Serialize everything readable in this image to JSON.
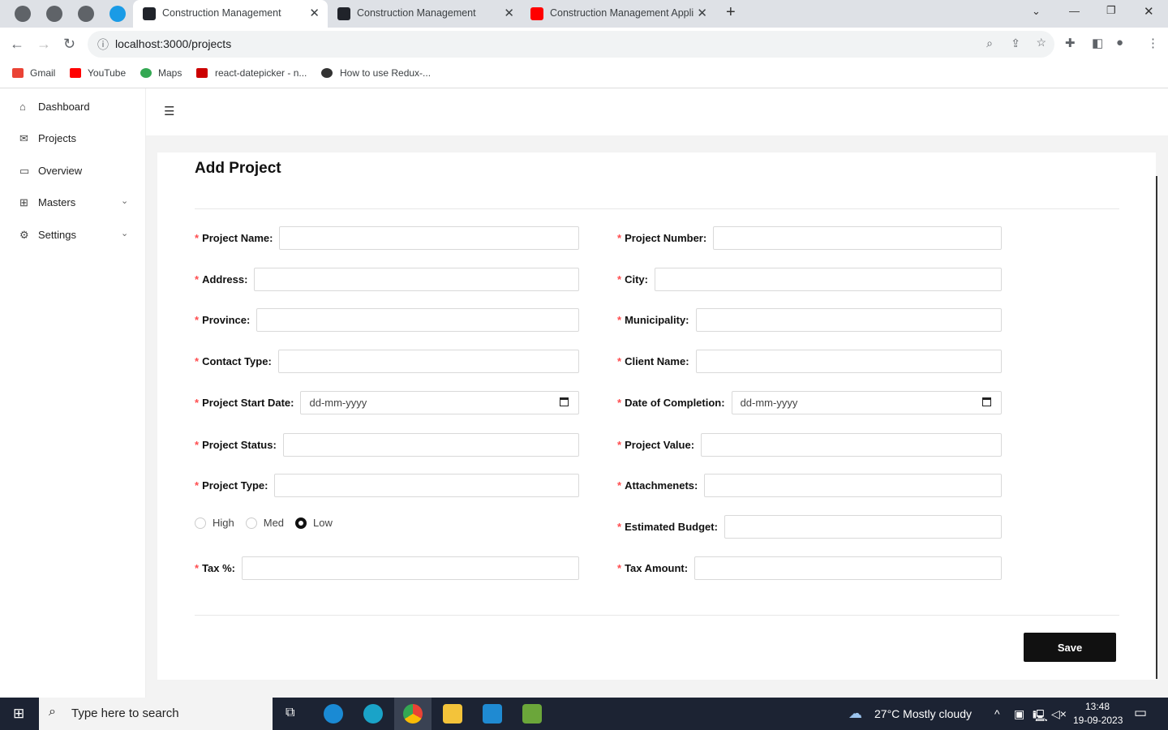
{
  "browser": {
    "tabs": [
      {
        "title": "Construction Management",
        "active": true
      },
      {
        "title": "Construction Management",
        "active": false
      },
      {
        "title": "Construction Management Appli",
        "active": false
      }
    ],
    "url": "localhost:3000/projects",
    "bookmarks": [
      "Gmail",
      "YouTube",
      "Maps",
      "react-datepicker - n...",
      "How to use Redux-..."
    ]
  },
  "sidebar": {
    "items": [
      {
        "label": "Dashboard",
        "icon": "home-icon"
      },
      {
        "label": "Projects",
        "icon": "mail-icon"
      },
      {
        "label": "Overview",
        "icon": "calendar-icon"
      },
      {
        "label": "Masters",
        "icon": "grid-icon"
      },
      {
        "label": "Settings",
        "icon": "gear-icon"
      }
    ]
  },
  "form": {
    "title": "Add Project",
    "left": [
      {
        "label": "Project Name:",
        "value": ""
      },
      {
        "label": "Address:",
        "value": ""
      },
      {
        "label": "Province:",
        "value": ""
      },
      {
        "label": "Contact Type:",
        "value": ""
      },
      {
        "label": "Project Start Date:",
        "value": "dd-mm-yyyy"
      },
      {
        "label": "Project Status:",
        "value": ""
      },
      {
        "label": "Project Type:",
        "value": ""
      },
      {
        "label": "Tax %:",
        "value": ""
      }
    ],
    "right": [
      {
        "label": "Project Number:",
        "value": ""
      },
      {
        "label": "City:",
        "value": ""
      },
      {
        "label": "Municipality:",
        "value": ""
      },
      {
        "label": "Client Name:",
        "value": ""
      },
      {
        "label": "Date of Completion:",
        "value": "dd-mm-yyyy"
      },
      {
        "label": "Project Value:",
        "value": ""
      },
      {
        "label": "Attachmenets:",
        "value": ""
      },
      {
        "label": "Estimated Budget:",
        "value": ""
      },
      {
        "label": "Tax Amount:",
        "value": ""
      }
    ],
    "priority": {
      "options": [
        "High",
        "Med",
        "Low"
      ],
      "selected": "Low"
    },
    "save_label": "Save"
  },
  "taskbar": {
    "search_placeholder": "Type here to search",
    "weather": "27°C  Mostly cloudy",
    "time": "13:48",
    "date": "19-09-2023"
  }
}
